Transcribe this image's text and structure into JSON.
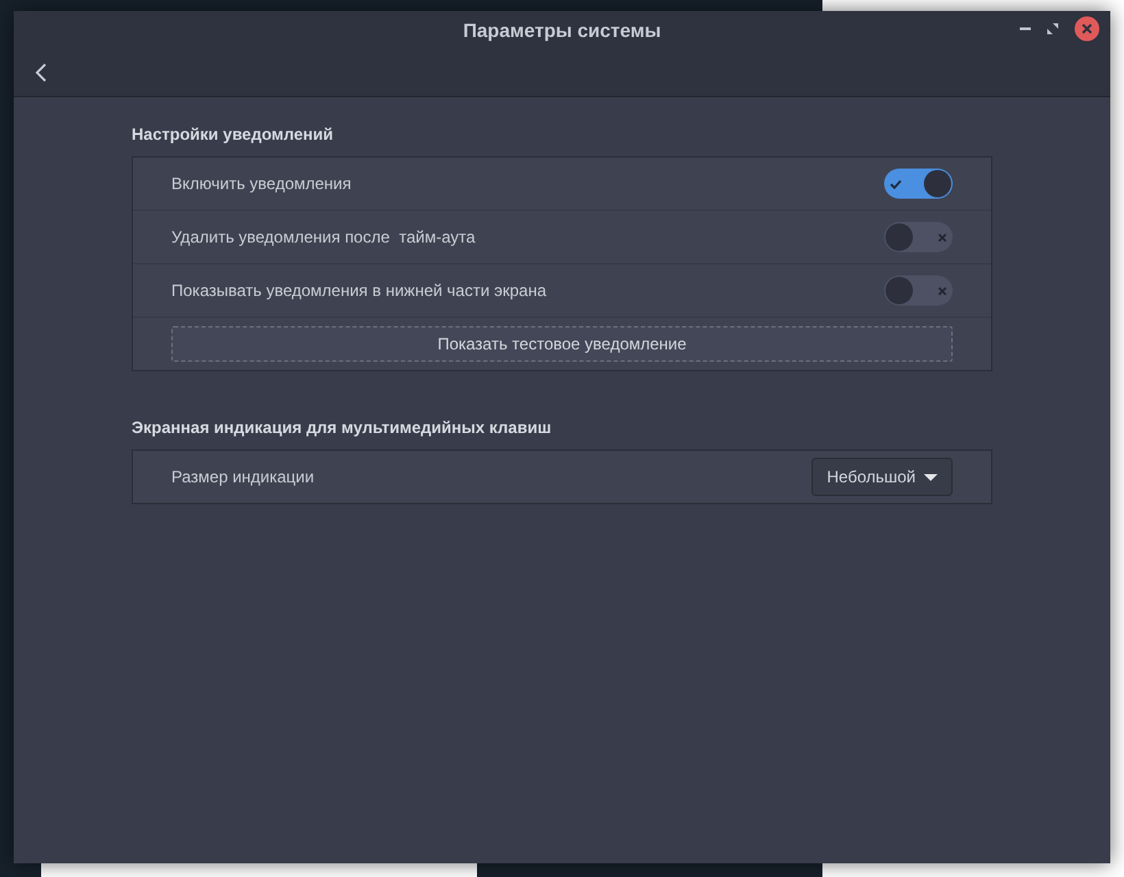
{
  "window": {
    "title": "Параметры системы"
  },
  "sections": [
    {
      "title": "Настройки уведомлений",
      "rows": [
        {
          "kind": "switch",
          "label": "Включить уведомления",
          "on": true
        },
        {
          "kind": "switch",
          "label": "Удалить уведомления после  тайм-аута",
          "on": false
        },
        {
          "kind": "switch",
          "label": "Показывать уведомления в нижней части экрана",
          "on": false
        },
        {
          "kind": "button",
          "label": "Показать тестовое уведомление"
        }
      ]
    },
    {
      "title": "Экранная индикация для мультимедийных клавиш",
      "rows": [
        {
          "kind": "dropdown",
          "label": "Размер индикации",
          "value": "Небольшой"
        }
      ]
    }
  ]
}
